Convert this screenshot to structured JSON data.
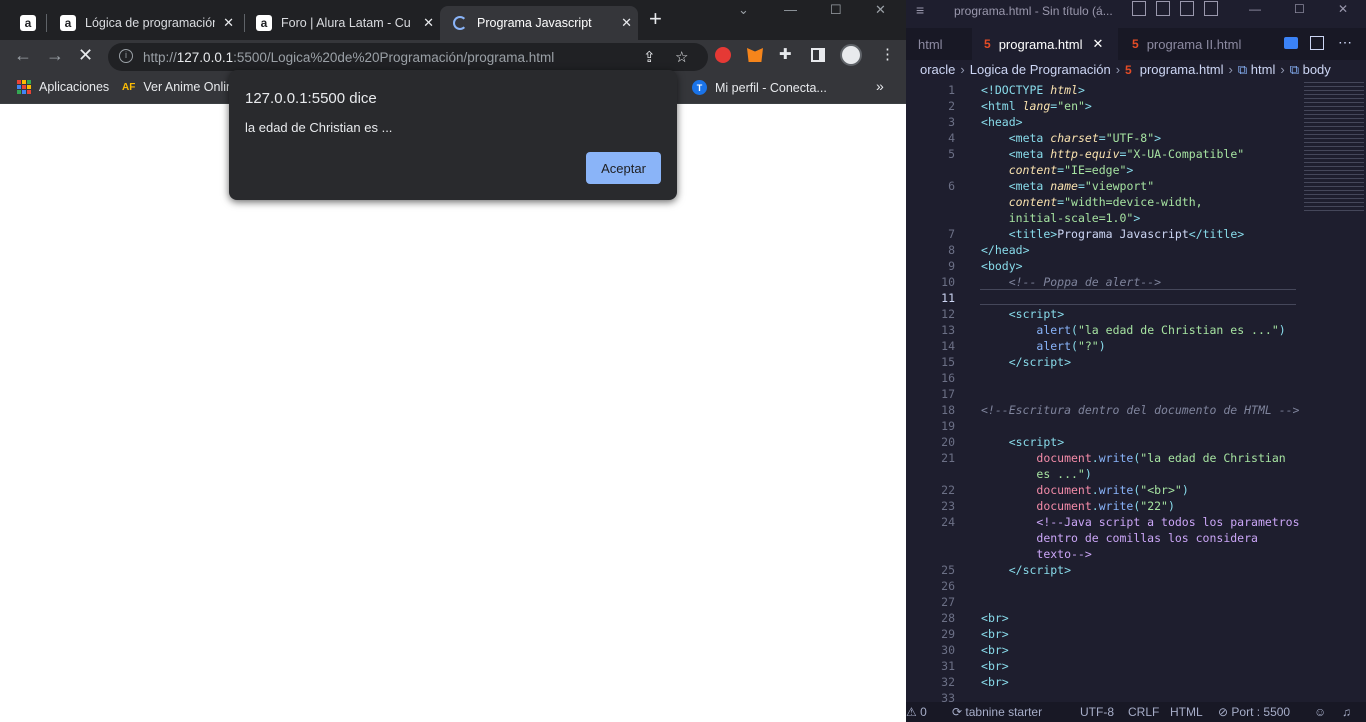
{
  "browser": {
    "tabs": [
      {
        "icon": "alura-icon",
        "label": ""
      },
      {
        "icon": "alura-icon",
        "label": "Lógica de programación: "
      },
      {
        "icon": "alura-icon",
        "label": "Foro | Alura Latam - Curs"
      },
      {
        "icon": "loading-icon",
        "label": "Programa Javascript",
        "active": true
      }
    ],
    "url_host": "127.0.0.1",
    "url_prefix": "http://",
    "url_rest": ":5500/Logica%20de%20Programación/programa.html",
    "bookmarks": [
      "Aplicaciones",
      "Ver Anime Onlin",
      "Mi perfil - Conecta..."
    ],
    "bookmark_tiles": [
      "#ea4335",
      "#fbbc04",
      "#34a853",
      "#4285f4",
      "#ea4335",
      "#fbbc04",
      "#34a853",
      "#4285f4",
      "#ea4335"
    ],
    "bookmark_icons": [
      "AF",
      "T"
    ]
  },
  "dialog": {
    "title": "127.0.0.1:5500 dice",
    "message": "la edad de Christian es ...",
    "ok_label": "Aceptar"
  },
  "vscode": {
    "title": "programa.html - Sin título (á...",
    "tabs": [
      "html",
      "programa.html",
      "programa II.html"
    ],
    "breadcrumbs": [
      "oracle",
      "Logica de Programación",
      "programa.html",
      "html",
      "body"
    ],
    "status": {
      "errors": "0",
      "tabnine": "tabnine starter",
      "encoding": "UTF-8",
      "eol": "CRLF",
      "language": "HTML",
      "port": "Port : 5500"
    },
    "lines": [
      {
        "n": "1",
        "code": [
          [
            "punc",
            "<!"
          ],
          [
            "tag",
            "DOCTYPE"
          ],
          [
            "txt",
            " "
          ],
          [
            "attr",
            "html"
          ],
          [
            "punc",
            ">"
          ]
        ]
      },
      {
        "n": "2",
        "code": [
          [
            "punc",
            "<"
          ],
          [
            "tag",
            "html"
          ],
          [
            "txt",
            " "
          ],
          [
            "attr",
            "lang"
          ],
          [
            "punc",
            "="
          ],
          [
            "str",
            "\"en\""
          ],
          [
            "punc",
            ">"
          ]
        ]
      },
      {
        "n": "3",
        "code": [
          [
            "punc",
            "<"
          ],
          [
            "tag",
            "head"
          ],
          [
            "punc",
            ">"
          ]
        ]
      },
      {
        "n": "4",
        "code": [
          [
            "txt",
            "    "
          ],
          [
            "punc",
            "<"
          ],
          [
            "tag",
            "meta"
          ],
          [
            "txt",
            " "
          ],
          [
            "attr",
            "charset"
          ],
          [
            "punc",
            "="
          ],
          [
            "str",
            "\"UTF-8\""
          ],
          [
            "punc",
            ">"
          ]
        ]
      },
      {
        "n": "5",
        "code": [
          [
            "txt",
            "    "
          ],
          [
            "punc",
            "<"
          ],
          [
            "tag",
            "meta"
          ],
          [
            "txt",
            " "
          ],
          [
            "attr",
            "http-equiv"
          ],
          [
            "punc",
            "="
          ],
          [
            "str",
            "\"X-UA-Compatible\""
          ]
        ]
      },
      {
        "n": "",
        "code": [
          [
            "txt",
            "    "
          ],
          [
            "attr",
            "content"
          ],
          [
            "punc",
            "="
          ],
          [
            "str",
            "\"IE=edge\""
          ],
          [
            "punc",
            ">"
          ]
        ]
      },
      {
        "n": "6",
        "code": [
          [
            "txt",
            "    "
          ],
          [
            "punc",
            "<"
          ],
          [
            "tag",
            "meta"
          ],
          [
            "txt",
            " "
          ],
          [
            "attr",
            "name"
          ],
          [
            "punc",
            "="
          ],
          [
            "str",
            "\"viewport\""
          ]
        ]
      },
      {
        "n": "",
        "code": [
          [
            "txt",
            "    "
          ],
          [
            "attr",
            "content"
          ],
          [
            "punc",
            "="
          ],
          [
            "str",
            "\"width=device-width,"
          ]
        ]
      },
      {
        "n": "",
        "code": [
          [
            "txt",
            "    "
          ],
          [
            "str",
            "initial-scale=1.0\""
          ],
          [
            "punc",
            ">"
          ]
        ]
      },
      {
        "n": "7",
        "code": [
          [
            "txt",
            "    "
          ],
          [
            "punc",
            "<"
          ],
          [
            "tag",
            "title"
          ],
          [
            "punc",
            ">"
          ],
          [
            "txt",
            "Programa Javascript"
          ],
          [
            "punc",
            "</"
          ],
          [
            "tag",
            "title"
          ],
          [
            "punc",
            ">"
          ]
        ]
      },
      {
        "n": "8",
        "code": [
          [
            "punc",
            "</"
          ],
          [
            "tag",
            "head"
          ],
          [
            "punc",
            ">"
          ]
        ]
      },
      {
        "n": "9",
        "code": [
          [
            "punc",
            "<"
          ],
          [
            "tag",
            "body"
          ],
          [
            "punc",
            ">"
          ]
        ]
      },
      {
        "n": "10",
        "code": [
          [
            "txt",
            "    "
          ],
          [
            "cmt",
            "<!-- Poppa de alert-->"
          ]
        ]
      },
      {
        "n": "11",
        "code": [],
        "cur": true
      },
      {
        "n": "12",
        "code": [
          [
            "txt",
            "    "
          ],
          [
            "punc",
            "<"
          ],
          [
            "tag",
            "script"
          ],
          [
            "punc",
            ">"
          ]
        ]
      },
      {
        "n": "13",
        "code": [
          [
            "txt",
            "        "
          ],
          [
            "fn",
            "alert"
          ],
          [
            "punc",
            "("
          ],
          [
            "str",
            "\"la edad de Christian es ...\""
          ],
          [
            "punc",
            ")"
          ]
        ]
      },
      {
        "n": "14",
        "code": [
          [
            "txt",
            "        "
          ],
          [
            "fn",
            "alert"
          ],
          [
            "punc",
            "("
          ],
          [
            "str",
            "\"?\""
          ],
          [
            "punc",
            ")"
          ]
        ]
      },
      {
        "n": "15",
        "code": [
          [
            "txt",
            "    "
          ],
          [
            "punc",
            "</"
          ],
          [
            "tag",
            "script"
          ],
          [
            "punc",
            ">"
          ]
        ]
      },
      {
        "n": "16",
        "code": []
      },
      {
        "n": "17",
        "code": []
      },
      {
        "n": "18",
        "code": [
          [
            "cmt",
            "<!--Escritura dentro del documento de HTML -->"
          ]
        ]
      },
      {
        "n": "19",
        "code": []
      },
      {
        "n": "20",
        "code": [
          [
            "txt",
            "    "
          ],
          [
            "punc",
            "<"
          ],
          [
            "tag",
            "script"
          ],
          [
            "punc",
            ">"
          ]
        ]
      },
      {
        "n": "21",
        "code": [
          [
            "txt",
            "        "
          ],
          [
            "id",
            "document"
          ],
          [
            "punc",
            "."
          ],
          [
            "fn",
            "write"
          ],
          [
            "punc",
            "("
          ],
          [
            "str",
            "\"la edad de Christian"
          ]
        ]
      },
      {
        "n": "",
        "code": [
          [
            "txt",
            "        "
          ],
          [
            "str",
            "es ...\""
          ],
          [
            "punc",
            ")"
          ]
        ]
      },
      {
        "n": "22",
        "code": [
          [
            "txt",
            "        "
          ],
          [
            "id",
            "document"
          ],
          [
            "punc",
            "."
          ],
          [
            "fn",
            "write"
          ],
          [
            "punc",
            "("
          ],
          [
            "str",
            "\"<br>\""
          ],
          [
            "punc",
            ")"
          ]
        ]
      },
      {
        "n": "23",
        "code": [
          [
            "txt",
            "        "
          ],
          [
            "id",
            "document"
          ],
          [
            "punc",
            "."
          ],
          [
            "fn",
            "write"
          ],
          [
            "punc",
            "("
          ],
          [
            "str",
            "\"22\""
          ],
          [
            "punc",
            ")"
          ]
        ]
      },
      {
        "n": "24",
        "code": [
          [
            "txt",
            "        "
          ],
          [
            "kw",
            "<!--Java script a todos los parametros"
          ]
        ]
      },
      {
        "n": "",
        "code": [
          [
            "txt",
            "        "
          ],
          [
            "kw",
            "dentro de comillas los considera"
          ]
        ]
      },
      {
        "n": "",
        "code": [
          [
            "txt",
            "        "
          ],
          [
            "kw",
            "texto-->"
          ]
        ]
      },
      {
        "n": "25",
        "code": [
          [
            "txt",
            "    "
          ],
          [
            "punc",
            "</"
          ],
          [
            "tag",
            "script"
          ],
          [
            "punc",
            ">"
          ]
        ]
      },
      {
        "n": "26",
        "code": []
      },
      {
        "n": "27",
        "code": []
      },
      {
        "n": "28",
        "code": [
          [
            "punc",
            "<"
          ],
          [
            "tag",
            "br"
          ],
          [
            "punc",
            ">"
          ]
        ]
      },
      {
        "n": "29",
        "code": [
          [
            "punc",
            "<"
          ],
          [
            "tag",
            "br"
          ],
          [
            "punc",
            ">"
          ]
        ]
      },
      {
        "n": "30",
        "code": [
          [
            "punc",
            "<"
          ],
          [
            "tag",
            "br"
          ],
          [
            "punc",
            ">"
          ]
        ]
      },
      {
        "n": "31",
        "code": [
          [
            "punc",
            "<"
          ],
          [
            "tag",
            "br"
          ],
          [
            "punc",
            ">"
          ]
        ]
      },
      {
        "n": "32",
        "code": [
          [
            "punc",
            "<"
          ],
          [
            "tag",
            "br"
          ],
          [
            "punc",
            ">"
          ]
        ]
      },
      {
        "n": "33",
        "code": []
      }
    ]
  }
}
